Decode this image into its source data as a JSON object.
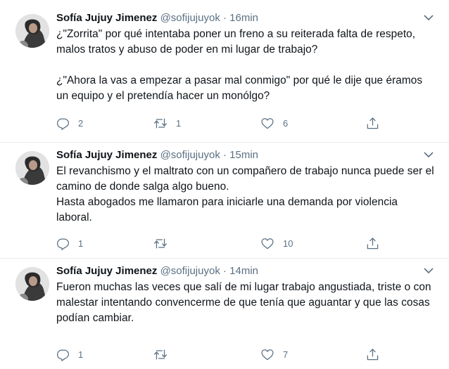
{
  "tweets": [
    {
      "name": "Sofía Jujuy Jimenez",
      "handle": "@sofijujuyok",
      "time": "· 16min",
      "paragraphs": [
        "¿\"Zorrita\" por qué intentaba poner un freno a su reiterada falta de respeto, malos tratos y abuso de poder en mi lugar de trabajo?",
        "",
        "¿\"Ahora la vas a empezar a pasar mal conmigo\" por qué le dije que éramos un equipo y el pretendía hacer un monólgo?"
      ],
      "replies": "2",
      "retweets": "1",
      "likes": "6"
    },
    {
      "name": "Sofía Jujuy Jimenez",
      "handle": "@sofijujuyok",
      "time": "· 15min",
      "paragraphs": [
        "El revanchismo y el maltrato con un compañero de trabajo nunca puede ser el camino de donde salga algo bueno.",
        "Hasta abogados me llamaron para iniciarle una demanda por violencia laboral."
      ],
      "replies": "1",
      "retweets": "",
      "likes": "10"
    },
    {
      "name": "Sofía Jujuy Jimenez",
      "handle": "@sofijujuyok",
      "time": "· 14min",
      "paragraphs": [
        "Fueron muchas las veces que salí de mi lugar trabajo angustiada, triste o con malestar intentando convencerme de que tenía que aguantar y que las cosas podían cambiar."
      ],
      "replies": "1",
      "retweets": "",
      "likes": "7"
    }
  ],
  "icons": {
    "reply": "reply-icon",
    "retweet": "retweet-icon",
    "like": "heart-icon",
    "share": "share-icon",
    "more": "chevron-down-icon"
  },
  "colors": {
    "text": "#0f1419",
    "secondary": "#5b7083",
    "divider": "#e6ecf0"
  }
}
